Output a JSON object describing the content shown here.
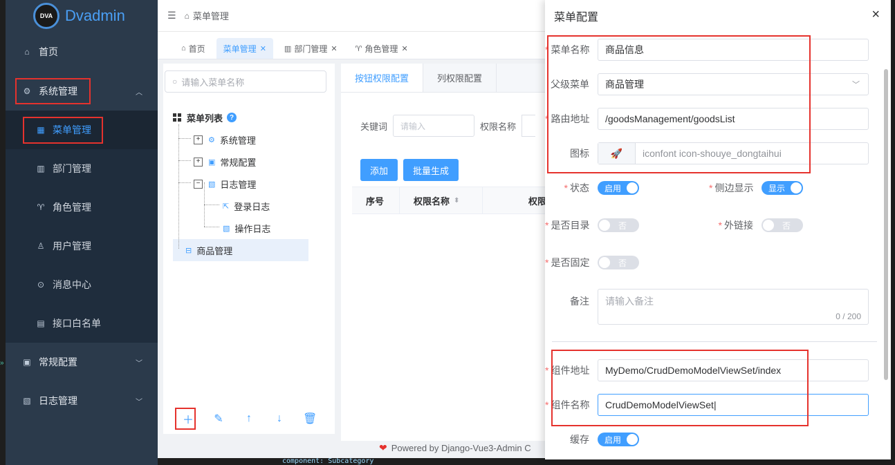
{
  "sidebar": {
    "logo_badge": "DVA",
    "logo_text": "Dvadmin",
    "items": [
      {
        "label": "首页"
      },
      {
        "label": "系统管理"
      },
      {
        "label": "菜单管理"
      },
      {
        "label": "部门管理"
      },
      {
        "label": "角色管理"
      },
      {
        "label": "用户管理"
      },
      {
        "label": "消息中心"
      },
      {
        "label": "接口白名单"
      },
      {
        "label": "常规配置"
      },
      {
        "label": "日志管理"
      }
    ]
  },
  "header": {
    "breadcrumb": "菜单管理"
  },
  "tabs": [
    {
      "label": "首页"
    },
    {
      "label": "菜单管理"
    },
    {
      "label": "部门管理"
    },
    {
      "label": "角色管理"
    }
  ],
  "tree": {
    "search_placeholder": "请输入菜单名称",
    "root": "菜单列表",
    "nodes": [
      "系统管理",
      "常规配置",
      "日志管理",
      "登录日志",
      "操作日志",
      "商品管理"
    ]
  },
  "perm": {
    "tab1": "按钮权限配置",
    "tab2": "列权限配置",
    "keyword_label": "关键词",
    "keyword_placeholder": "请输入",
    "perm_name_label": "权限名称",
    "add_btn": "添加",
    "batch_btn": "批量生成",
    "col_index": "序号",
    "col_name": "权限名称",
    "col_3": "权限"
  },
  "footer": "Powered by Django-Vue3-Admin C",
  "code_text": "component: Subcategory",
  "drawer": {
    "title": "菜单配置",
    "close": "×",
    "name_label": "菜单名称",
    "name_value": "商品信息",
    "parent_label": "父级菜单",
    "parent_value": "商品管理",
    "route_label": "路由地址",
    "route_value": "/goodsManagement/goodsList",
    "icon_label": "图标",
    "icon_value": "iconfont icon-shouye_dongtaihui",
    "status_label": "状态",
    "status_value": "启用",
    "sidebar_show_label": "侧边显示",
    "sidebar_show_value": "显示",
    "is_catalog_label": "是否目录",
    "is_catalog_value": "否",
    "external_label": "外链接",
    "external_value": "否",
    "fixed_label": "是否固定",
    "fixed_value": "否",
    "remark_label": "备注",
    "remark_placeholder": "请输入备注",
    "remark_count": "0 / 200",
    "component_label": "组件地址",
    "component_value": "MyDemo/CrudDemoModelViewSet/index",
    "component_name_label": "组件名称",
    "component_name_value": "CrudDemoModelViewSet",
    "cache_label": "缓存",
    "cache_value": "启用"
  },
  "colors": {
    "accent": "#409eff",
    "sidebar_bg": "#2b3a4b",
    "highlight_red": "#e5322d"
  }
}
